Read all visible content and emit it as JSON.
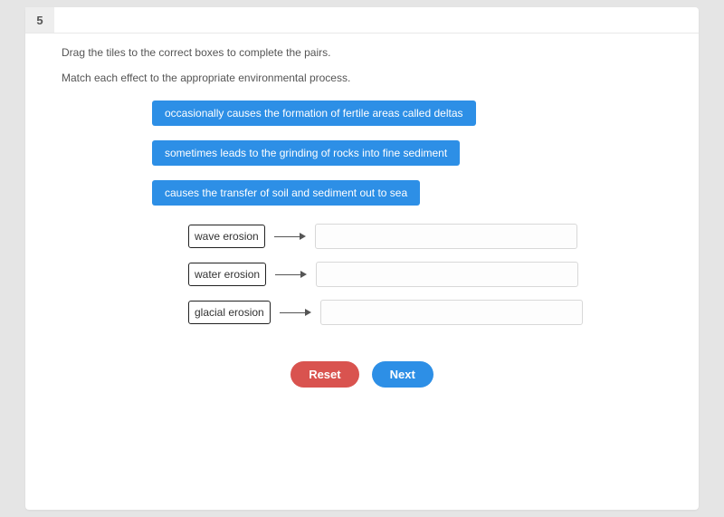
{
  "question": {
    "number": "5",
    "instruction1": "Drag the tiles to the correct boxes to complete the pairs.",
    "instruction2": "Match each effect to the appropriate environmental process."
  },
  "tiles": [
    "occasionally causes the formation of fertile areas called deltas",
    "sometimes leads to the grinding of rocks into fine sediment",
    "causes the transfer of soil and sediment out to sea"
  ],
  "targets": [
    {
      "label": "wave erosion"
    },
    {
      "label": "water erosion"
    },
    {
      "label": "glacial erosion"
    }
  ],
  "controls": {
    "reset": "Reset",
    "next": "Next"
  }
}
